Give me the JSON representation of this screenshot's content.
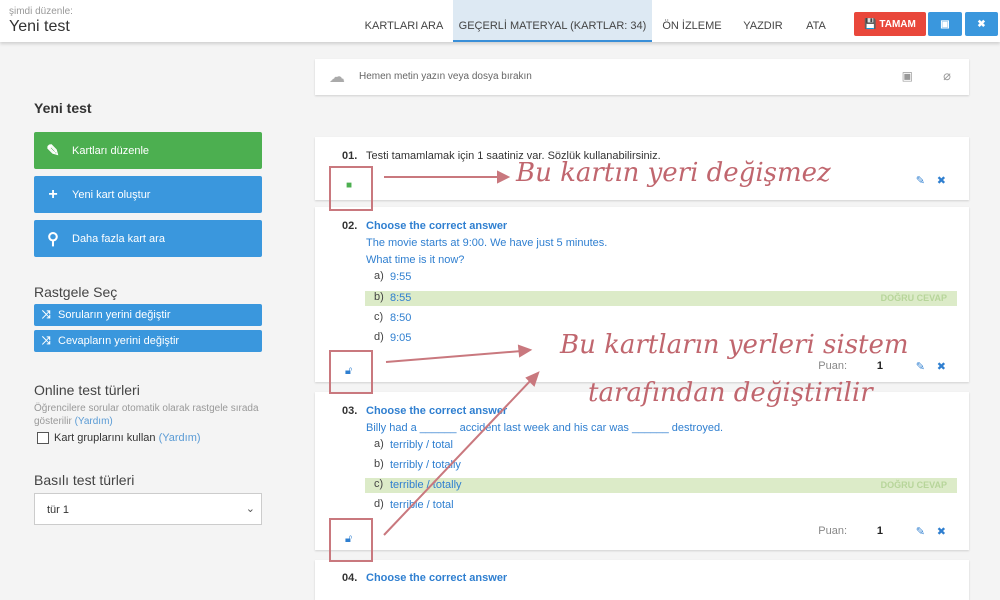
{
  "header": {
    "subtitle": "şimdi düzenle:",
    "title": "Yeni test",
    "tabs": [
      {
        "label": "KARTLARI ARA"
      },
      {
        "label": "GEÇERLİ MATERYAL (KARTLAR: 34)"
      },
      {
        "label": "ÖN İZLEME"
      },
      {
        "label": "YAZDIR"
      },
      {
        "label": "ATA"
      }
    ],
    "done_label": "TAMAM"
  },
  "upload": {
    "placeholder": "Hemen metin yazın veya dosya bırakın"
  },
  "sidebar": {
    "title": "Yeni test",
    "buttons": [
      {
        "label": "Kartları düzenle"
      },
      {
        "label": "Yeni kart oluştur"
      },
      {
        "label": "Daha fazla kart ara"
      }
    ],
    "random_title": "Rastgele Seç",
    "random_buttons": [
      {
        "label": "Soruların yerini değiştir"
      },
      {
        "label": "Cevapların yerini değiştir"
      }
    ],
    "online_title": "Online test türleri",
    "online_desc": "Öğrencilere sorular otomatik olarak rastgele sırada gösterilir",
    "help": "(Yardım)",
    "checkbox_label": "Kart gruplarını kullan",
    "printed_title": "Basılı test türleri",
    "printed_select": "tür 1"
  },
  "cards": [
    {
      "num": "01.",
      "text": "Testi tamamlamak için 1 saatiniz var. Sözlük kullanabilirsiniz."
    },
    {
      "num": "02.",
      "title": "Choose the correct answer",
      "lines": [
        "The movie starts at 9:00. We have just 5 minutes.",
        "What time is it now?"
      ],
      "options": [
        {
          "l": "a)",
          "v": "9:55"
        },
        {
          "l": "b)",
          "v": "8:55"
        },
        {
          "l": "c)",
          "v": "8:50"
        },
        {
          "l": "d)",
          "v": "9:05"
        }
      ],
      "puan": "1"
    },
    {
      "num": "03.",
      "title": "Choose the correct answer",
      "lines": [
        "Billy had a ______ accident last week and his car was ______ destroyed."
      ],
      "options": [
        {
          "l": "a)",
          "v": "terribly / total"
        },
        {
          "l": "b)",
          "v": "terribly / totally"
        },
        {
          "l": "c)",
          "v": "terrible / totally"
        },
        {
          "l": "d)",
          "v": "terrible / total"
        }
      ],
      "puan": "1"
    },
    {
      "num": "04.",
      "title": "Choose the correct answer"
    }
  ],
  "labels": {
    "correct": "DOĞRU CEVAP",
    "puan": "Puan:"
  },
  "annotations": {
    "a1": "Bu kartın yeri değişmez",
    "a2": "Bu kartların yerleri sistem",
    "a3": "tarafından değiştirilir"
  },
  "colors": {
    "accent": "#3a97dd",
    "green": "#4caf50",
    "red": "#e9473b",
    "annotation": "#c0666e"
  }
}
